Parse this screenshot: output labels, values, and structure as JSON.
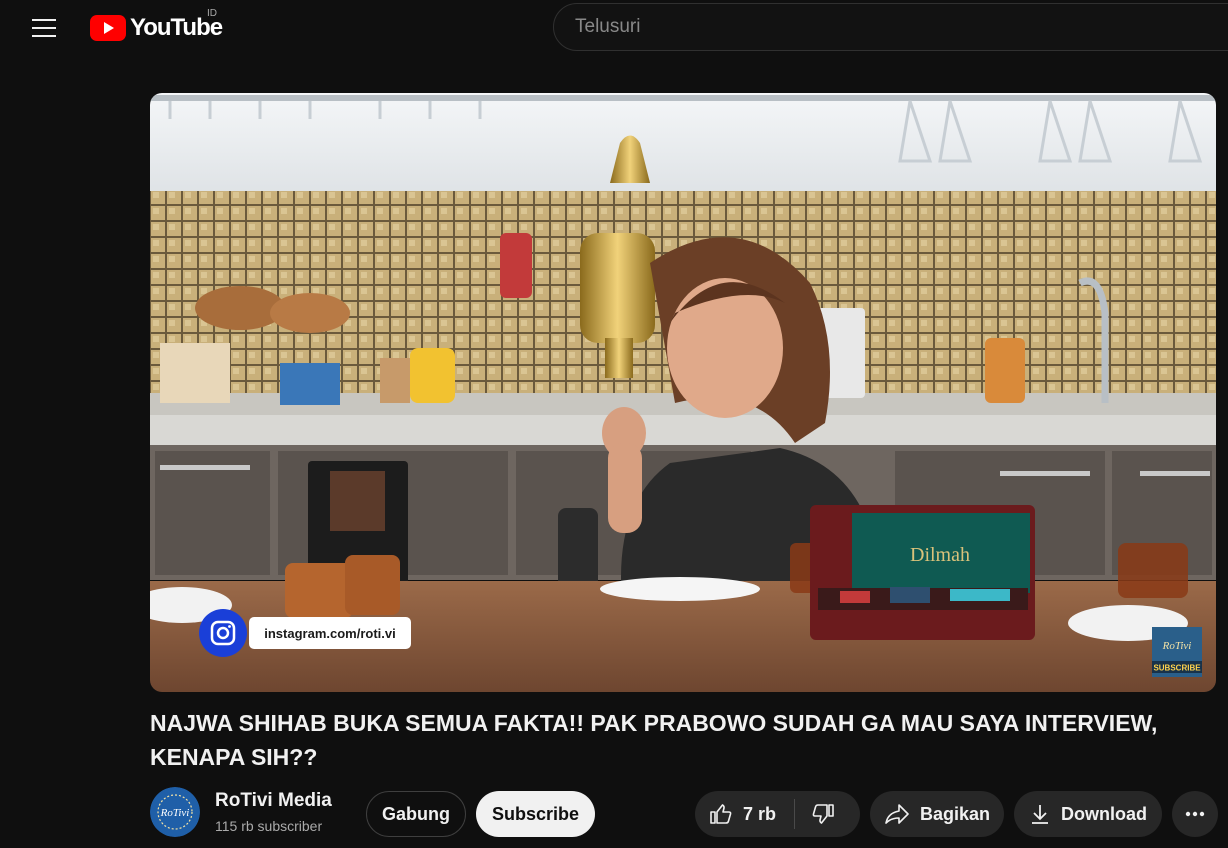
{
  "header": {
    "logo_text": "YouTube",
    "country_code": "ID",
    "search_placeholder": "Telusuri"
  },
  "video": {
    "title": "NAJWA SHIHAB BUKA SEMUA FAKTA!! PAK PRABOWO SUDAH GA MAU SAYA INTERVIEW, KENAPA SIH??",
    "overlay_instagram": "instagram.com/roti.vi",
    "watermark_logo_text": "RoTivi",
    "watermark_subscribe": "SUBSCRIBE",
    "box_brand": "Dilmah"
  },
  "channel": {
    "name": "RoTivi Media",
    "subscribers": "115 rb subscriber",
    "avatar_text": "RoTivi"
  },
  "actions": {
    "join_label": "Gabung",
    "subscribe_label": "Subscribe",
    "like_count": "7 rb",
    "share_label": "Bagikan",
    "download_label": "Download"
  },
  "colors": {
    "background": "#0f0f0f",
    "brand_red": "#ff0000",
    "button_bg": "#272727",
    "subscribe_bg": "#f1f1f1"
  },
  "icons": [
    "menu-icon",
    "youtube-play-icon",
    "thumbs-up-icon",
    "thumbs-down-icon",
    "share-icon",
    "download-icon",
    "more-icon",
    "instagram-icon"
  ]
}
